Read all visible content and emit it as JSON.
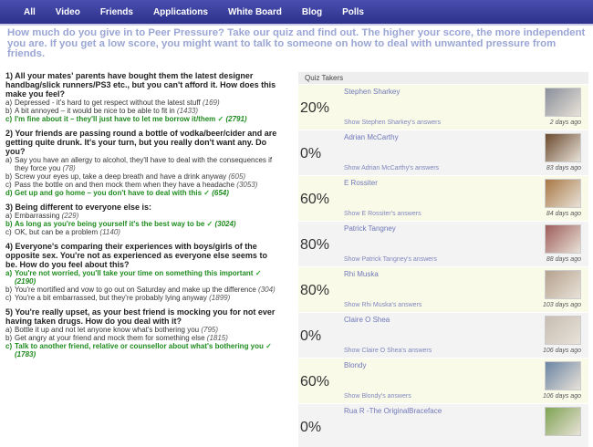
{
  "nav": {
    "items": [
      "All",
      "Video",
      "Friends",
      "Applications",
      "White Board",
      "Blog",
      "Polls"
    ]
  },
  "intro": "How much do you give in to Peer Pressure? Take our quiz and find out. The higher your score, the more independent you are. If you get a low score, you might want to talk to someone on how to deal with unwanted pressure from friends.",
  "questions": [
    {
      "title": "1) All your mates' parents have bought them the latest designer handbag/slick runners/PS3 etc., but you can't afford it. How does this make you feel?",
      "options": [
        {
          "letter": "a)",
          "text": "Depressed - it's hard to get respect without the latest stuff",
          "count": "(169)",
          "selected": false
        },
        {
          "letter": "b)",
          "text": "A bit annoyed – it would be nice to be able to fit in",
          "count": "(1433)",
          "selected": false
        },
        {
          "letter": "c)",
          "text": "I'm fine about it – they'll just have to let me borrow it/them",
          "count": "(2791)",
          "selected": true
        }
      ]
    },
    {
      "title": "2) Your friends are passing round a bottle of vodka/beer/cider and are getting quite drunk. It's your turn, but you really don't want any. Do you?",
      "options": [
        {
          "letter": "a)",
          "text": "Say you have an allergy to alcohol, they'll have to deal with the consequences if they force you",
          "count": "(78)",
          "selected": false
        },
        {
          "letter": "b)",
          "text": "Screw your eyes up, take a deep breath and have a drink anyway",
          "count": "(605)",
          "selected": false
        },
        {
          "letter": "c)",
          "text": "Pass the bottle on and then mock them when they have a headache",
          "count": "(3053)",
          "selected": false
        },
        {
          "letter": "d)",
          "text": "Get up and go home – you don't have to deal with this",
          "count": "(654)",
          "selected": true
        }
      ]
    },
    {
      "title": "3) Being different to everyone else is:",
      "options": [
        {
          "letter": "a)",
          "text": "Embarrassing",
          "count": "(229)",
          "selected": false
        },
        {
          "letter": "b)",
          "text": "As long as you're being yourself it's the best way to be",
          "count": "(3024)",
          "selected": true
        },
        {
          "letter": "c)",
          "text": "OK, but can be a problem",
          "count": "(1140)",
          "selected": false
        }
      ]
    },
    {
      "title": "4) Everyone's comparing their experiences with boys/girls of the opposite sex. You're not as experienced as everyone else seems to be. How do you feel about this?",
      "options": [
        {
          "letter": "a)",
          "text": "You're not worried, you'll take your time on something this important",
          "count": "(2190)",
          "selected": true
        },
        {
          "letter": "b)",
          "text": "You're mortified and vow to go out on Saturday and make up the difference",
          "count": "(304)",
          "selected": false
        },
        {
          "letter": "c)",
          "text": "You're a bit embarrassed, but they're probably lying anyway",
          "count": "(1899)",
          "selected": false
        }
      ]
    },
    {
      "title": "5) You're really upset, as your best friend is mocking you for not ever having taken drugs. How do you deal with it?",
      "options": [
        {
          "letter": "a)",
          "text": "Bottle it up and not let anyone know what's bothering you",
          "count": "(795)",
          "selected": false
        },
        {
          "letter": "b)",
          "text": "Get angry at your friend and mock them for something else",
          "count": "(1815)",
          "selected": false
        },
        {
          "letter": "c)",
          "text": "Talk to another friend, relative or counsellor about what's bothering you",
          "count": "(1783)",
          "selected": true
        }
      ]
    }
  ],
  "takers": {
    "header": "Quiz Takers",
    "items": [
      {
        "name": "Stephen Sharkey",
        "pct": "20%",
        "link": "Show Stephen Sharkey's answers",
        "when": "2 days ago",
        "photo_color": "#8a8f9b"
      },
      {
        "name": "Adrian McCarthy",
        "pct": "0%",
        "link": "Show Adrian McCarthy's answers",
        "when": "83 days ago",
        "photo_color": "#6b4a2e"
      },
      {
        "name": "E Rossiter",
        "pct": "60%",
        "link": "Show E Rossiter's answers",
        "when": "84 days ago",
        "photo_color": "#a97844"
      },
      {
        "name": "Patrick Tangney",
        "pct": "80%",
        "link": "Show Patrick Tangney's answers",
        "when": "88 days ago",
        "photo_color": "#9e5c5a"
      },
      {
        "name": "Rhi Muska",
        "pct": "80%",
        "link": "Show Rhi Muska's answers",
        "when": "103 days ago",
        "photo_color": "#b5a18e"
      },
      {
        "name": "Claire O Shea",
        "pct": "0%",
        "link": "Show Claire O Shea's answers",
        "when": "106 days ago",
        "photo_color": "#c7bdb2"
      },
      {
        "name": "Blondy",
        "pct": "60%",
        "link": "Show Blondy's answers",
        "when": "106 days ago",
        "photo_color": "#6b84a3"
      },
      {
        "name": "Rua R -The OriginalBraceface",
        "pct": "0%",
        "link": "",
        "when": "",
        "photo_color": "#7ea352"
      }
    ]
  }
}
